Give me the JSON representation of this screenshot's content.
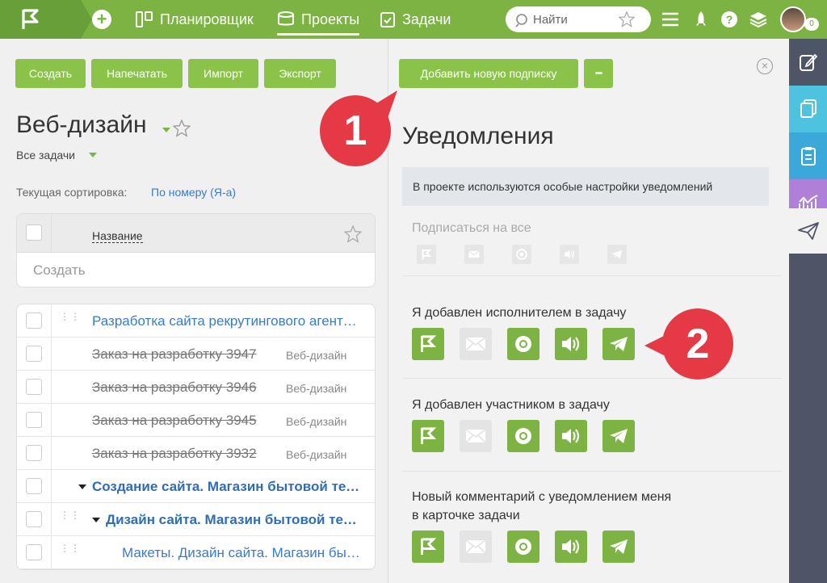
{
  "nav": {
    "items": [
      {
        "label": "Планировщик"
      },
      {
        "label": "Проекты"
      },
      {
        "label": "Задачи"
      }
    ],
    "search_placeholder": "Найти",
    "notif_count": "0"
  },
  "toolbar": {
    "create": "Создать",
    "print": "Напечатать",
    "import": "Импорт",
    "export": "Экспорт"
  },
  "project": {
    "title": "Веб-дизайн",
    "filter": "Все задачи",
    "sort_label": "Текущая сортировка:",
    "sort_value": "По номеру (Я-а)"
  },
  "table": {
    "col_name": "Название",
    "create_placeholder": "Создать",
    "rows": [
      {
        "title": "Разработка сайта рекрутингового агентства",
        "project": ""
      },
      {
        "title": "Заказ на разработку 3947",
        "project": "Веб-дизайн"
      },
      {
        "title": "Заказ на разработку 3946",
        "project": "Веб-дизайн"
      },
      {
        "title": "Заказ на разработку 3945",
        "project": "Веб-дизайн"
      },
      {
        "title": "Заказ на разработку 3932",
        "project": "Веб-дизайн"
      },
      {
        "title": "Создание сайта. Магазин бытовой техники",
        "project": ""
      },
      {
        "title": "Дизайн сайта. Магазин бытовой техники",
        "project": ""
      },
      {
        "title": "Макеты. Дизайн сайта. Магазин бытовой техники",
        "project": ""
      }
    ]
  },
  "notifications": {
    "add_subscription": "Добавить новую подписку",
    "more": "•••",
    "title": "Уведомления",
    "info": "В проекте используются особые настройки уведомлений",
    "subscribe_all": "Подписаться на все",
    "rows": [
      {
        "label": "Я добавлен исполнителем в задачу"
      },
      {
        "label": "Я добавлен участником в задачу"
      },
      {
        "label_line1": "Новый комментарий с уведомлением меня",
        "label_line2": "в карточке задачи"
      }
    ]
  },
  "callouts": {
    "one": "1",
    "two": "2"
  },
  "colors": {
    "brand": "#7cb342",
    "callout": "#e63946",
    "link": "#3a7bc8"
  },
  "icons": [
    "flag-icon",
    "mail-icon",
    "chrome-icon",
    "sound-icon",
    "telegram-icon"
  ]
}
